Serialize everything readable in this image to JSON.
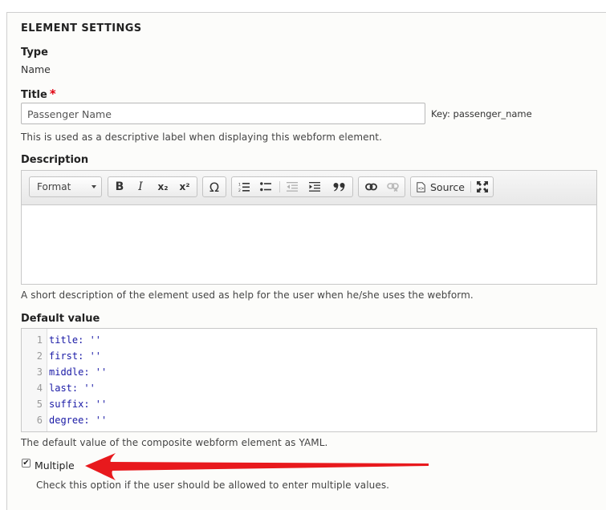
{
  "section": {
    "legend": "ELEMENT SETTINGS"
  },
  "type": {
    "label": "Type",
    "value": "Name"
  },
  "title": {
    "label": "Title",
    "required_mark": "*",
    "value": "Passenger Name",
    "machine_name": "Key: passenger_name",
    "help": "This is used as a descriptive label when displaying this webform element."
  },
  "description": {
    "label": "Description",
    "toolbar": {
      "format_label": "Format",
      "bold": "B",
      "italic": "I",
      "subscript": "x₂",
      "superscript": "x²",
      "special_char": "Ω",
      "source_label": "Source"
    },
    "help": "A short description of the element used as help for the user when he/she uses the webform."
  },
  "default_value": {
    "label": "Default value",
    "lines": [
      {
        "n": "1",
        "text": "title: ''"
      },
      {
        "n": "2",
        "text": "first: ''"
      },
      {
        "n": "3",
        "text": "middle: ''"
      },
      {
        "n": "4",
        "text": "last: ''"
      },
      {
        "n": "5",
        "text": "suffix: ''"
      },
      {
        "n": "6",
        "text": "degree: ''"
      }
    ],
    "help": "The default value of the composite webform element as YAML."
  },
  "multiple": {
    "label": "Multiple",
    "checked": true,
    "help": "Check this option if the user should be allowed to enter multiple values."
  },
  "colors": {
    "arrow": "#e8191d",
    "required": "#e0000e"
  }
}
